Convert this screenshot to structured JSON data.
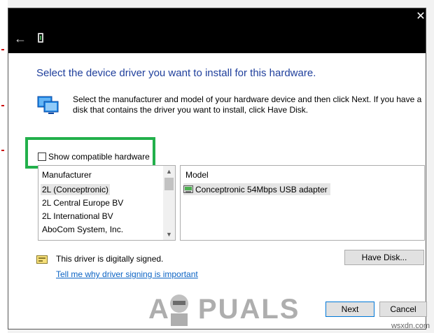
{
  "dialog": {
    "back_icon": "back-arrow-icon",
    "device_icon": "device-icon",
    "close_label": "✕",
    "heading": "Select the device driver you want to install for this hardware.",
    "description": "Select the manufacturer and model of your hardware device and then click Next. If you have a disk that contains the driver you want to install, click Have Disk.",
    "show_compatible": {
      "label": "Show compatible hardware",
      "checked": false
    },
    "manufacturer": {
      "header": "Manufacturer",
      "items": [
        "2L (Conceptronic)",
        "2L Central Europe BV",
        "2L International BV",
        "AboCom System, Inc."
      ],
      "selected": "2L (Conceptronic)"
    },
    "model": {
      "header": "Model",
      "items": [
        "Conceptronic 54Mbps USB adapter"
      ]
    },
    "signed_text": "This driver is digitally signed.",
    "signing_link": "Tell me why driver signing is important",
    "have_disk_label": "Have Disk...",
    "next_label": "Next",
    "cancel_label": "Cancel"
  },
  "watermark": {
    "text": "APPUALS",
    "site": "wsxdn.com"
  },
  "colors": {
    "heading": "#1f3f9c",
    "highlight_box": "#22b04b",
    "link": "#0b63c4",
    "titlebar": "#000000"
  }
}
